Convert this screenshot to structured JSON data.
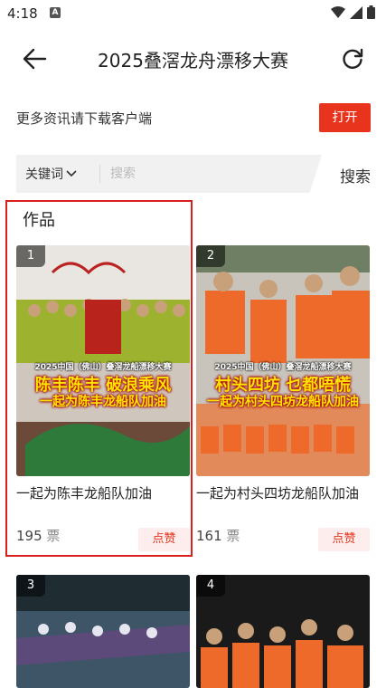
{
  "status_bar": {
    "time": "4:18",
    "notification_badge": "A"
  },
  "header": {
    "title": "2025叠滘龙舟漂移大赛"
  },
  "promo": {
    "text": "更多资讯请下载客户端",
    "button_label": "打开"
  },
  "search": {
    "filter_label": "关键词",
    "placeholder": "搜索",
    "button_label": "搜索"
  },
  "works": {
    "section_title": "作品",
    "items": [
      {
        "rank": "1",
        "overlay_small": "2025中国（佛山）叠滘龙船漂移大赛",
        "overlay_big": "陈丰陈丰 破浪乘风",
        "overlay_sub": "一起为陈丰龙船队加油",
        "caption": "一起为陈丰龙船队加油",
        "votes": "195",
        "votes_unit": "票",
        "like_label": "点赞"
      },
      {
        "rank": "2",
        "overlay_small": "2025中国（佛山）叠滘龙船漂移大赛",
        "overlay_big": "村头四坊 乜都唔慌",
        "overlay_sub": "一起为村头四坊龙船队加油",
        "caption": "一起为村头四坊龙船队加油",
        "votes": "161",
        "votes_unit": "票",
        "like_label": "点赞"
      },
      {
        "rank": "3"
      },
      {
        "rank": "4"
      }
    ]
  },
  "colors": {
    "accent": "#e8341c",
    "highlight_border": "#d9201c",
    "like_bg": "#fdeeed"
  }
}
